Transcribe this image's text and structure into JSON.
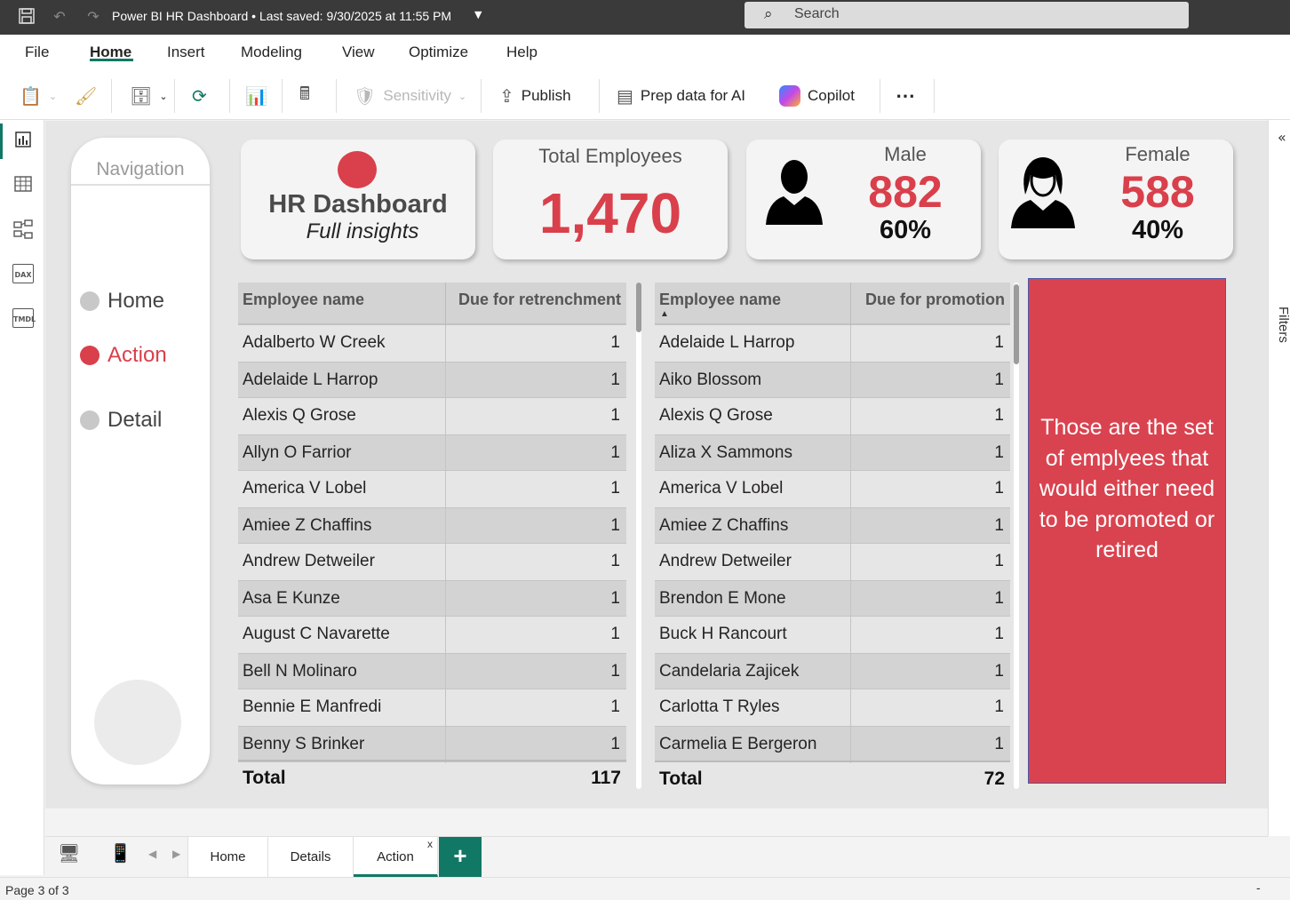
{
  "titlebar": {
    "title": "Power BI HR Dashboard • Last saved: 9/30/2025 at 11:55 PM",
    "search_placeholder": "Search"
  },
  "menu": [
    "File",
    "Home",
    "Insert",
    "Modeling",
    "View",
    "Optimize",
    "Help"
  ],
  "menu_active": "Home",
  "ribbon": {
    "sensitivity_label": "Sensitivity",
    "publish_label": "Publish",
    "prep_label": "Prep data for AI",
    "copilot_label": "Copilot",
    "more_label": "⋯"
  },
  "rail": {
    "dax": "DAX",
    "tmdl": "TMDL"
  },
  "right_pane": {
    "filters_label": "Filters"
  },
  "navigation": {
    "title": "Navigation",
    "items": [
      {
        "label": "Home",
        "active": false
      },
      {
        "label": "Action",
        "active": true
      },
      {
        "label": "Detail",
        "active": false
      }
    ]
  },
  "cards": {
    "header_title": "HR Dashboard",
    "header_subtitle": "Full insights",
    "total_label": "Total Employees",
    "total_value": "1,470",
    "male_label": "Male",
    "male_value": "882",
    "male_pct": "60%",
    "female_label": "Female",
    "female_value": "588",
    "female_pct": "40%"
  },
  "table_retrenchment": {
    "headers": [
      "Employee name",
      "Due for retrenchment"
    ],
    "rows": [
      [
        "Adalberto W Creek",
        "1"
      ],
      [
        "Adelaide L Harrop",
        "1"
      ],
      [
        "Alexis Q Grose",
        "1"
      ],
      [
        "Allyn O Farrior",
        "1"
      ],
      [
        "America V Lobel",
        "1"
      ],
      [
        "Amiee Z Chaffins",
        "1"
      ],
      [
        "Andrew Detweiler",
        "1"
      ],
      [
        "Asa E Kunze",
        "1"
      ],
      [
        "August C Navarette",
        "1"
      ],
      [
        "Bell N Molinaro",
        "1"
      ],
      [
        "Bennie E Manfredi",
        "1"
      ],
      [
        "Benny S Brinker",
        "1"
      ]
    ],
    "total_label": "Total",
    "total_value": "117"
  },
  "table_promotion": {
    "headers": [
      "Employee name",
      "Due for promotion"
    ],
    "rows": [
      [
        "Adelaide L Harrop",
        "1"
      ],
      [
        "Aiko Blossom",
        "1"
      ],
      [
        "Alexis Q Grose",
        "1"
      ],
      [
        "Aliza X Sammons",
        "1"
      ],
      [
        "America V Lobel",
        "1"
      ],
      [
        "Amiee Z Chaffins",
        "1"
      ],
      [
        "Andrew Detweiler",
        "1"
      ],
      [
        "Brendon E Mone",
        "1"
      ],
      [
        "Buck H Rancourt",
        "1"
      ],
      [
        "Candelaria Zajicek",
        "1"
      ],
      [
        "Carlotta T Ryles",
        "1"
      ],
      [
        "Carmelia E Bergeron",
        "1"
      ]
    ],
    "total_label": "Total",
    "total_value": "72"
  },
  "note_text": "Those are the set of emplyees that would either need to be promoted or retired",
  "page_tabs": [
    {
      "label": "Home",
      "active": false
    },
    {
      "label": "Details",
      "active": false
    },
    {
      "label": "Action",
      "active": true
    }
  ],
  "close_tab": "x",
  "add_tab": "+",
  "status": {
    "page": "Page 3 of 3",
    "zoom_minus": "-"
  },
  "colors": {
    "accent": "#117865",
    "red": "#d9404b"
  }
}
